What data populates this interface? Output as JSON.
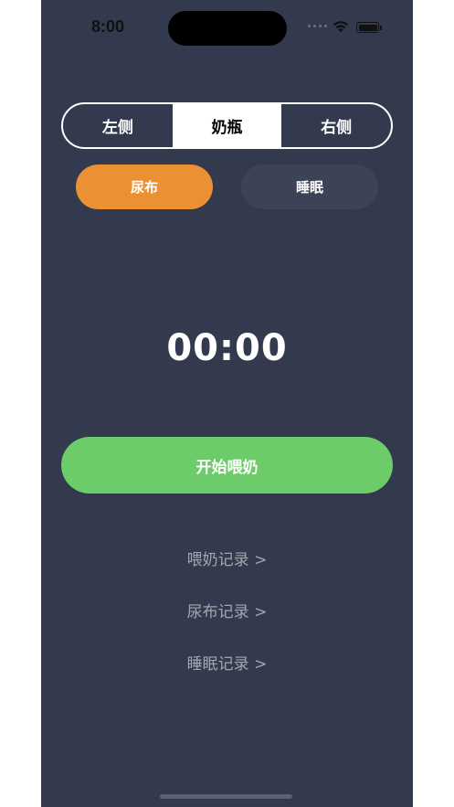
{
  "status_bar": {
    "time": "8:00"
  },
  "feeding_mode": {
    "options": [
      "左侧",
      "奶瓶",
      "右侧"
    ],
    "selected": "奶瓶"
  },
  "record_types": {
    "diaper_label": "尿布",
    "sleep_label": "睡眠"
  },
  "timer": {
    "display": "00:00"
  },
  "start_button": {
    "label": "开始喂奶"
  },
  "links": {
    "feeding_records": "喂奶记录 >",
    "diaper_records": "尿布记录 >",
    "sleep_records": "睡眠记录 >"
  },
  "colors": {
    "background": "#333a4d",
    "diaper_accent": "#ec9133",
    "sleep_button": "#3d4356",
    "start_button": "#6ccc69",
    "link_text": "#a3a6ae"
  },
  "icons": [
    "signal-dots-icon",
    "wifi-icon",
    "battery-icon"
  ]
}
